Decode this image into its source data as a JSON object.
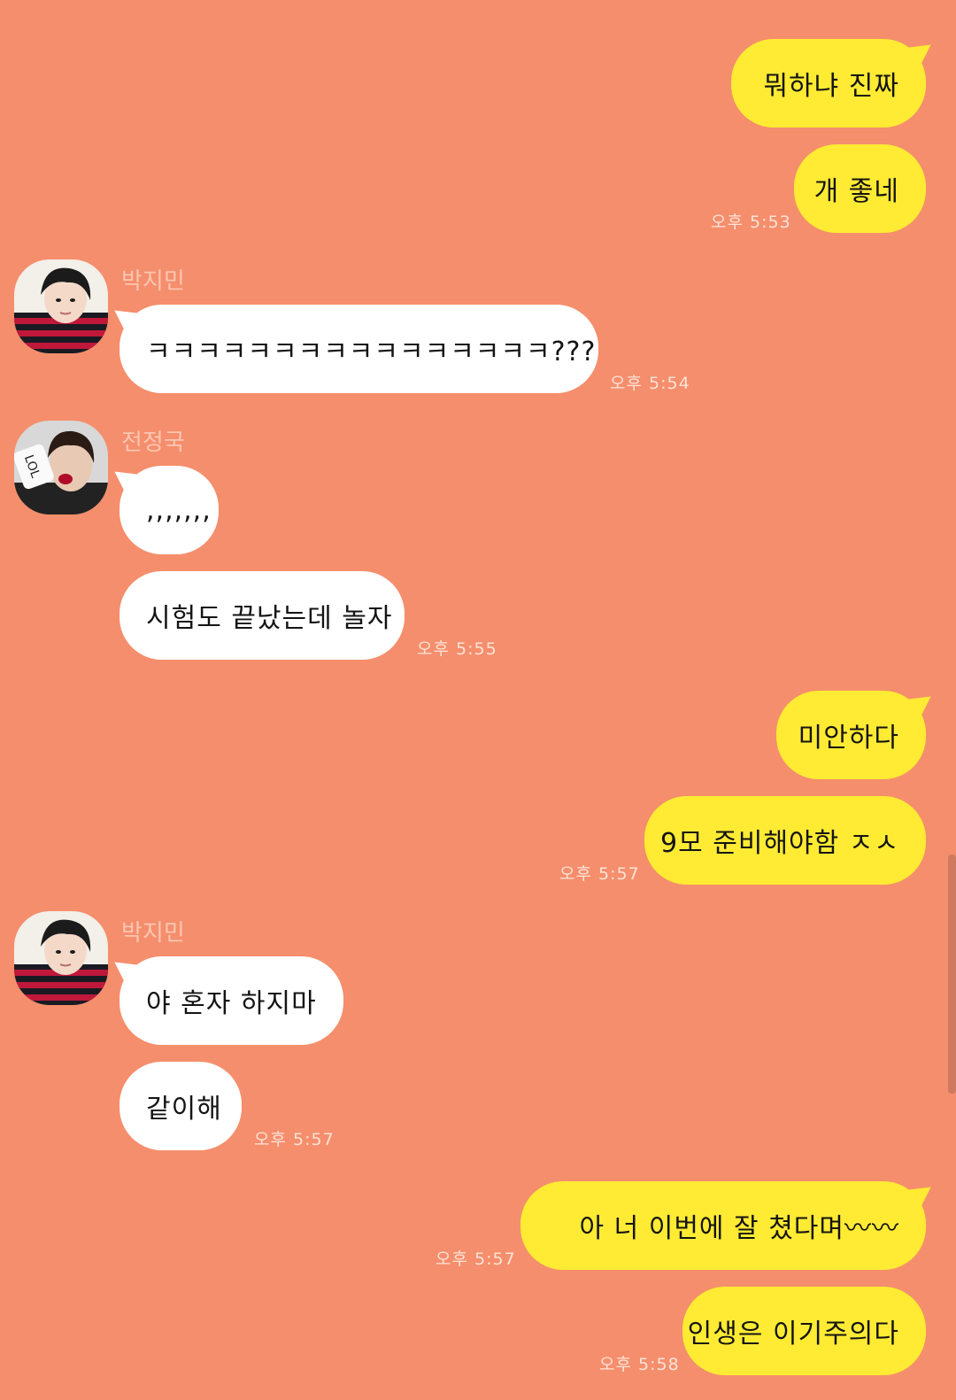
{
  "chat": {
    "background_color": "#f58e6c",
    "my_bubble_color": "#ffeb33",
    "their_bubble_color": "#ffffff",
    "messages": [
      {
        "from": "me",
        "text": "뭐하냐 진짜",
        "time": ""
      },
      {
        "from": "me",
        "text": "개 좋네",
        "time": "오후 5:53"
      },
      {
        "from": "박지민",
        "sender_label": "박지민",
        "text": "ㅋㅋㅋㅋㅋㅋㅋㅋㅋㅋㅋㅋㅋㅋㅋㅋ???",
        "time": "오후 5:54"
      },
      {
        "from": "전정국",
        "sender_label": "전정국",
        "text": ",,,,,,,",
        "time": ""
      },
      {
        "from": "전정국",
        "text": "시험도 끝났는데 놀자",
        "time": "오후 5:55"
      },
      {
        "from": "me",
        "text": "미안하다",
        "time": ""
      },
      {
        "from": "me",
        "text": "9모 준비해야함 ㅈㅅ",
        "time": "오후 5:57"
      },
      {
        "from": "박지민",
        "sender_label": "박지민",
        "text": "야 혼자 하지마",
        "time": ""
      },
      {
        "from": "박지민",
        "text": "같이해",
        "time": "오후 5:57"
      },
      {
        "from": "me",
        "text": "아 너 이번에 잘 쳤다며〰〰",
        "time": "오후 5:57"
      },
      {
        "from": "me",
        "text": "인생은 이기주의다",
        "time": "오후 5:58"
      }
    ]
  },
  "avatars": {
    "jimin": {
      "icon": "profile-photo-jimin",
      "bg": "#f3efe9",
      "hair": "#1b1b1b",
      "skin": "#f4d9c8",
      "shirt_a": "#c0183a",
      "shirt_b": "#1a1a22"
    },
    "jungkook": {
      "icon": "profile-photo-jungkook",
      "bg": "#d8d8d8",
      "hair": "#2a1c15",
      "skin": "#e8c9b3",
      "lips": "#b00c2a",
      "sign": "#222222"
    }
  }
}
